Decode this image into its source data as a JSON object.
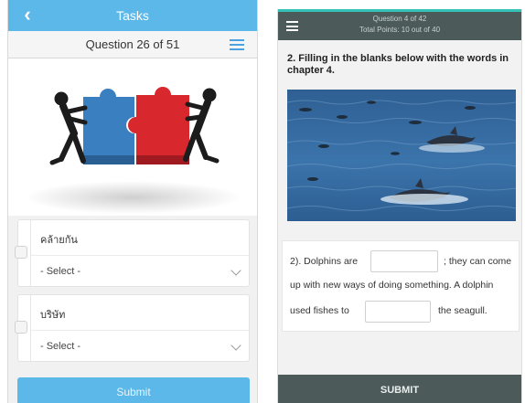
{
  "left": {
    "header": {
      "back_icon": "chevron-left-icon",
      "title": "Tasks"
    },
    "question_bar": {
      "text": "Question 26 of 51",
      "menu_icon": "menu-icon"
    },
    "image": {
      "subject": "two figures pushing blue and red puzzle pieces together",
      "colors": {
        "blue": "#3a7fc0",
        "red": "#d9272e",
        "figure": "#1c1c1c"
      }
    },
    "items": [
      {
        "word": "คล้ายกัน",
        "select": "- Select -",
        "chevron_icon": "chevron-down-icon"
      },
      {
        "word": "บริษัท",
        "select": "- Select -",
        "chevron_icon": "chevron-down-icon"
      }
    ],
    "submit_label": "Submit",
    "accent_color": "#5bb8e8"
  },
  "right": {
    "header": {
      "menu_icon": "hamburger-icon",
      "line1": "Question 4 of 42",
      "line2": "Total Points: 10 out of 40"
    },
    "accent_color": "#34c3b6",
    "header_color": "#4c5a5a",
    "prompt": "2. Filling in the blanks below with the words in chapter 4.",
    "photo": {
      "subject": "dolphins swimming in blue sea water"
    },
    "sentence": {
      "part1": "2). Dolphins are",
      "part2": "; they can come",
      "part3": "up with new ways of doing something. A dolphin",
      "part4": "used fishes to",
      "part5": "the seagull."
    },
    "blanks": [
      {
        "value": ""
      },
      {
        "value": ""
      }
    ],
    "submit_label": "SUBMIT"
  }
}
